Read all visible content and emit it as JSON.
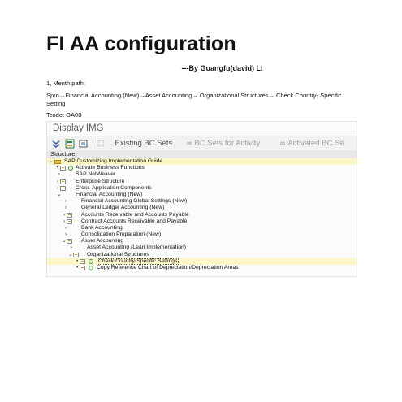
{
  "doc": {
    "title": "FI AA configuration",
    "byline": "---By Guangfu(david)  Li",
    "section_heading": "1, Menth path:",
    "path": "Spro→Financial Accounting (New)→Asset Accounting→ Organizational Structures→ Check Country- Specific Setting",
    "tcode": "Tcode: OA08"
  },
  "sap": {
    "panel_title": "Display IMG",
    "toolbar": {
      "existing_bc_sets": "Existing BC Sets",
      "bc_sets_for_activity": "BC Sets for Activity",
      "activated_bc_sets": "Activated BC Se"
    },
    "structure_label": "Structure",
    "tree": [
      {
        "label": "SAP Customizing Implementation Guide"
      },
      {
        "label": "Activate Business Functions"
      },
      {
        "label": "SAP NetWeaver"
      },
      {
        "label": "Enterprise Structure"
      },
      {
        "label": "Cross-Application Components"
      },
      {
        "label": "Financial Accounting (New)"
      },
      {
        "label": "Financial Accounting Global Settings (New)"
      },
      {
        "label": "General Ledger Accounting (New)"
      },
      {
        "label": "Accounts Receivable and Accounts Payable"
      },
      {
        "label": "Contract Accounts Receivable and Payable"
      },
      {
        "label": "Bank Accounting"
      },
      {
        "label": "Consolidation Preparation (New)"
      },
      {
        "label": "Asset Accounting"
      },
      {
        "label": "Asset Accounting (Lean Implementation)"
      },
      {
        "label": "Organizational Structures"
      },
      {
        "label": "Check Country-Specific Settings"
      },
      {
        "label": "Copy Reference Chart of Depreciation/Depreciation Areas"
      }
    ]
  }
}
